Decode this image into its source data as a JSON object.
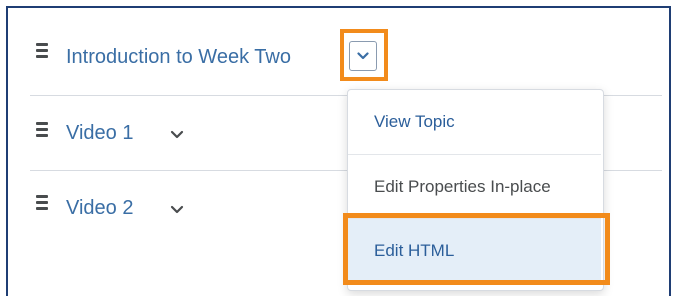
{
  "topics": [
    {
      "title": "Introduction to Week Two"
    },
    {
      "title": "Video 1"
    },
    {
      "title": "Video 2"
    }
  ],
  "context_menu": {
    "items": [
      {
        "label": "View Topic"
      },
      {
        "label": "Edit Properties In-place"
      },
      {
        "label": "Edit HTML"
      }
    ]
  },
  "colors": {
    "link": "#3a6ea5",
    "highlight": "#f28b1b",
    "frame": "#1f3e74",
    "selected_bg": "#e4eef8"
  },
  "icons": {
    "drag_handle": "drag-handle-icon",
    "chevron": "chevron-down-icon"
  }
}
